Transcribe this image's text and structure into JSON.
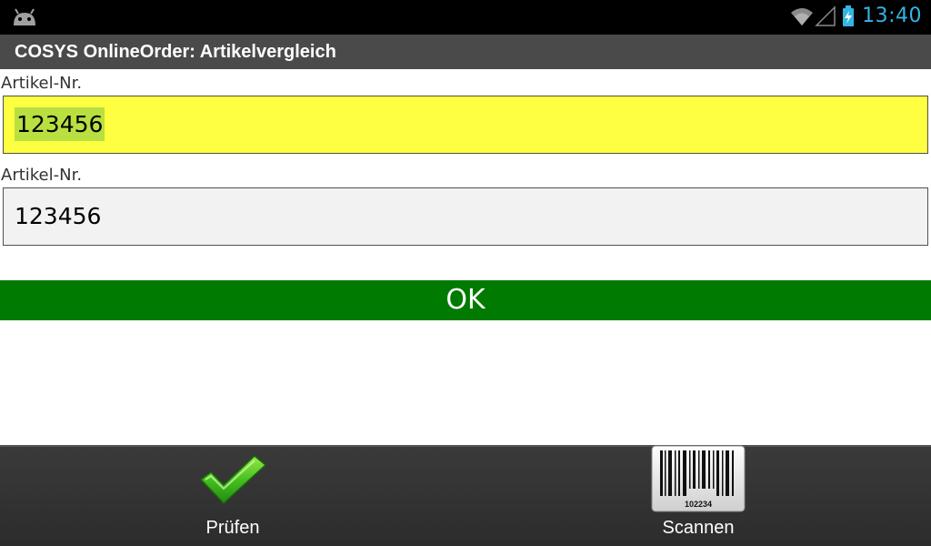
{
  "status_bar": {
    "time": "13:40",
    "icons": [
      "android-icon",
      "wifi-icon",
      "signal-icon",
      "battery-charging-icon"
    ],
    "clock_color": "#33b5e5"
  },
  "title_bar": {
    "title": "COSYS OnlineOrder: Artikelvergleich"
  },
  "form": {
    "field1": {
      "label": "Artikel-Nr.",
      "value": "123456",
      "focused": true
    },
    "field2": {
      "label": "Artikel-Nr.",
      "value": "123456",
      "focused": false
    }
  },
  "result": {
    "text": "OK",
    "color": "#007a00"
  },
  "bottom_bar": {
    "check_label": "Prüfen",
    "scan_label": "Scannen",
    "barcode_number": "102234"
  },
  "colors": {
    "focused_field": "#fdff40",
    "selection": "#b8e040",
    "title_bar": "#4a4a4a"
  }
}
